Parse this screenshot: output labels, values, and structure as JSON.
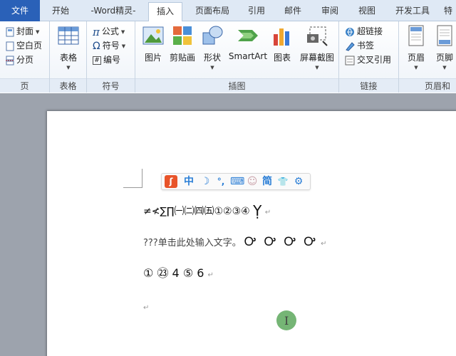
{
  "tabs": [
    {
      "label": "文件"
    },
    {
      "label": "开始"
    },
    {
      "label": "-Word精灵-"
    },
    {
      "label": "插入"
    },
    {
      "label": "页面布局"
    },
    {
      "label": "引用"
    },
    {
      "label": "邮件"
    },
    {
      "label": "审阅"
    },
    {
      "label": "视图"
    },
    {
      "label": "开发工具"
    },
    {
      "label": "特"
    }
  ],
  "ribbon": {
    "page_group": {
      "label": "页",
      "items": [
        "封面",
        "空白页",
        "分页"
      ]
    },
    "table_group": {
      "label": "表格",
      "button": "表格"
    },
    "symbol_group": {
      "label": "符号",
      "items": [
        "公式",
        "符号",
        "编号"
      ]
    },
    "illustration_group": {
      "label": "插图",
      "items": [
        "图片",
        "剪贴画",
        "形状",
        "SmartArt",
        "图表",
        "屏幕截图"
      ]
    },
    "link_group": {
      "label": "链接",
      "items": [
        "超链接",
        "书签",
        "交叉引用"
      ]
    },
    "header_group": {
      "label": "页眉和页",
      "items": [
        "页眉",
        "页脚"
      ]
    }
  },
  "colors": {
    "file_tab": "#2a61b8",
    "ime_accent": "#2a7ed6",
    "cursor_badge": "#6aaf6a"
  },
  "ime_toolbar": {
    "logo": "ʃ",
    "mode": "中",
    "moon": "☽",
    "punct": "°,",
    "keyboard": "⌨",
    "person": "☺",
    "simplified": "简",
    "shirt": "👕",
    "gear": "⚙"
  },
  "document": {
    "line1": "≠≮∑∏㈠㈡㈣㈤①②③④",
    "line1_glyph": "Ỵ",
    "line2_prefix": "???单击此处输入文字。",
    "line2_glyphs": "Ꭴ Ꭴ Ꭴ Ꭴ",
    "line3_parts": [
      "①",
      "㉓",
      "4",
      "⑤",
      "6"
    ],
    "para_mark": "↵"
  }
}
